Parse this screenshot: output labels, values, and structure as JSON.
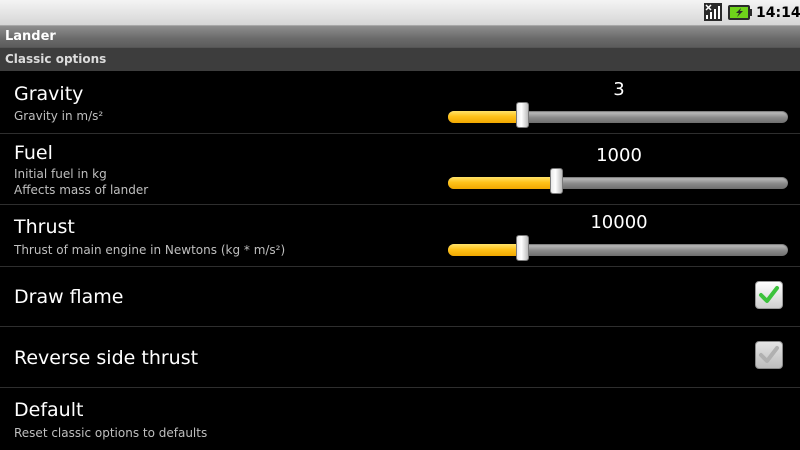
{
  "status_bar": {
    "time": "14:14",
    "icons": [
      "signal-icon",
      "battery-charging-icon"
    ]
  },
  "app": {
    "title": "Lander"
  },
  "category": {
    "label": "Classic options"
  },
  "preferences": {
    "gravity": {
      "title": "Gravity",
      "summary": "Gravity in m/s²",
      "value": "3",
      "fraction": 0.22
    },
    "fuel": {
      "title": "Fuel",
      "summary_line1": "Initial fuel in kg",
      "summary_line2": "Affects mass of lander",
      "value": "1000",
      "fraction": 0.32
    },
    "thrust": {
      "title": "Thrust",
      "summary": "Thrust of main engine in Newtons (kg * m/s²)",
      "value": "10000",
      "fraction": 0.22
    },
    "draw_flame": {
      "title": "Draw flame",
      "checked": true,
      "enabled": true
    },
    "reverse_side_thrust": {
      "title": "Reverse side thrust",
      "checked": true,
      "enabled": false
    },
    "default": {
      "title": "Default",
      "summary": "Reset classic options to defaults"
    }
  },
  "colors": {
    "slider_fill": "#ffc21a",
    "check_green": "#3cc23c",
    "check_disabled": "#b0b0b0"
  }
}
